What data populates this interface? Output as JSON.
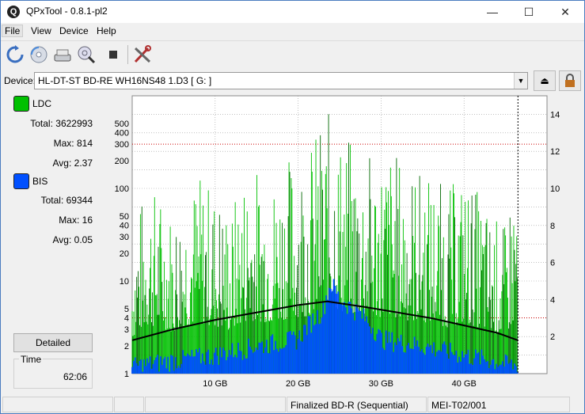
{
  "window": {
    "title": "QPxTool - 0.8.1-pl2",
    "icon_glyph": "Q"
  },
  "menu": [
    {
      "label": "File"
    },
    {
      "label": "View"
    },
    {
      "label": "Device"
    },
    {
      "label": "Help"
    }
  ],
  "toolbar": [
    "refresh-icon",
    "disc-icon",
    "scanner-icon",
    "search-disc-icon",
    "stop-icon",
    "tools-icon"
  ],
  "device": {
    "label": "Device:",
    "value": "HL-DT-ST BD-RE  WH16NS48  1.D3 [ G: ]"
  },
  "ldc": {
    "label": "LDC",
    "color": "#00c000",
    "total_label": "Total:",
    "total": "3622993",
    "max_label": "Max:",
    "max": "814",
    "avg_label": "Avg:",
    "avg": "2.37"
  },
  "bis": {
    "label": "BIS",
    "color": "#0050ff",
    "total_label": "Total:",
    "total": "69344",
    "max_label": "Max:",
    "max": "16",
    "avg_label": "Avg:",
    "avg": "0.05"
  },
  "detailed_label": "Detailed",
  "time": {
    "label": "Time",
    "value": "62:06"
  },
  "status": {
    "disc_type": "Finalized BD-R (Sequential)",
    "media_id": "MEI-T02/001"
  },
  "chart_data": {
    "type": "bar",
    "x_unit": "GB",
    "x_range": [
      0,
      50
    ],
    "x_ticks": [
      {
        "v": 10,
        "label": "10 GB"
      },
      {
        "v": 20,
        "label": "20 GB"
      },
      {
        "v": 30,
        "label": "30 GB"
      },
      {
        "v": 40,
        "label": "40 GB"
      }
    ],
    "y_left": {
      "scale": "log",
      "range": [
        1,
        1000
      ],
      "tick_labels": [
        1,
        2,
        3,
        4,
        5,
        10,
        20,
        30,
        40,
        50,
        100,
        200,
        300,
        400,
        500
      ]
    },
    "y_right": {
      "range": [
        0,
        15
      ],
      "tick_labels": [
        2,
        4,
        6,
        8,
        10,
        12,
        14
      ]
    },
    "ldc_envelope": [
      [
        0,
        30
      ],
      [
        2,
        120
      ],
      [
        4,
        80
      ],
      [
        5,
        60
      ],
      [
        8,
        150
      ],
      [
        12,
        60
      ],
      [
        14,
        200
      ],
      [
        17,
        150
      ],
      [
        19,
        250
      ],
      [
        21,
        300
      ],
      [
        22,
        400
      ],
      [
        23,
        650
      ],
      [
        24,
        700
      ],
      [
        25,
        450
      ],
      [
        27,
        300
      ],
      [
        29,
        250
      ],
      [
        31,
        300
      ],
      [
        33,
        200
      ],
      [
        36,
        150
      ],
      [
        38,
        100
      ],
      [
        40,
        150
      ],
      [
        43,
        60
      ],
      [
        45,
        40
      ],
      [
        46.5,
        200
      ]
    ],
    "bis_envelope": [
      [
        0,
        1.5
      ],
      [
        10,
        2
      ],
      [
        20,
        3
      ],
      [
        23,
        6
      ],
      [
        24,
        12
      ],
      [
        25,
        8
      ],
      [
        30,
        3
      ],
      [
        40,
        2
      ],
      [
        46.5,
        1.5
      ]
    ],
    "speed": [
      [
        0,
        1.8
      ],
      [
        5,
        2.4
      ],
      [
        10,
        2.9
      ],
      [
        15,
        3.3
      ],
      [
        20,
        3.7
      ],
      [
        23.5,
        3.9
      ],
      [
        28,
        3.6
      ],
      [
        32,
        3.3
      ],
      [
        36,
        3.0
      ],
      [
        40,
        2.6
      ],
      [
        44,
        2.2
      ],
      [
        46.5,
        1.8
      ]
    ],
    "series": [
      {
        "name": "LDC"
      },
      {
        "name": "BIS"
      }
    ],
    "colors": {
      "ldc_light": "#00c000",
      "ldc_dark": "#006800",
      "bis": "#0050ff",
      "speed": "#000000",
      "grid": "#999999",
      "redline": "#cc0000"
    },
    "x_end": 46.5
  }
}
